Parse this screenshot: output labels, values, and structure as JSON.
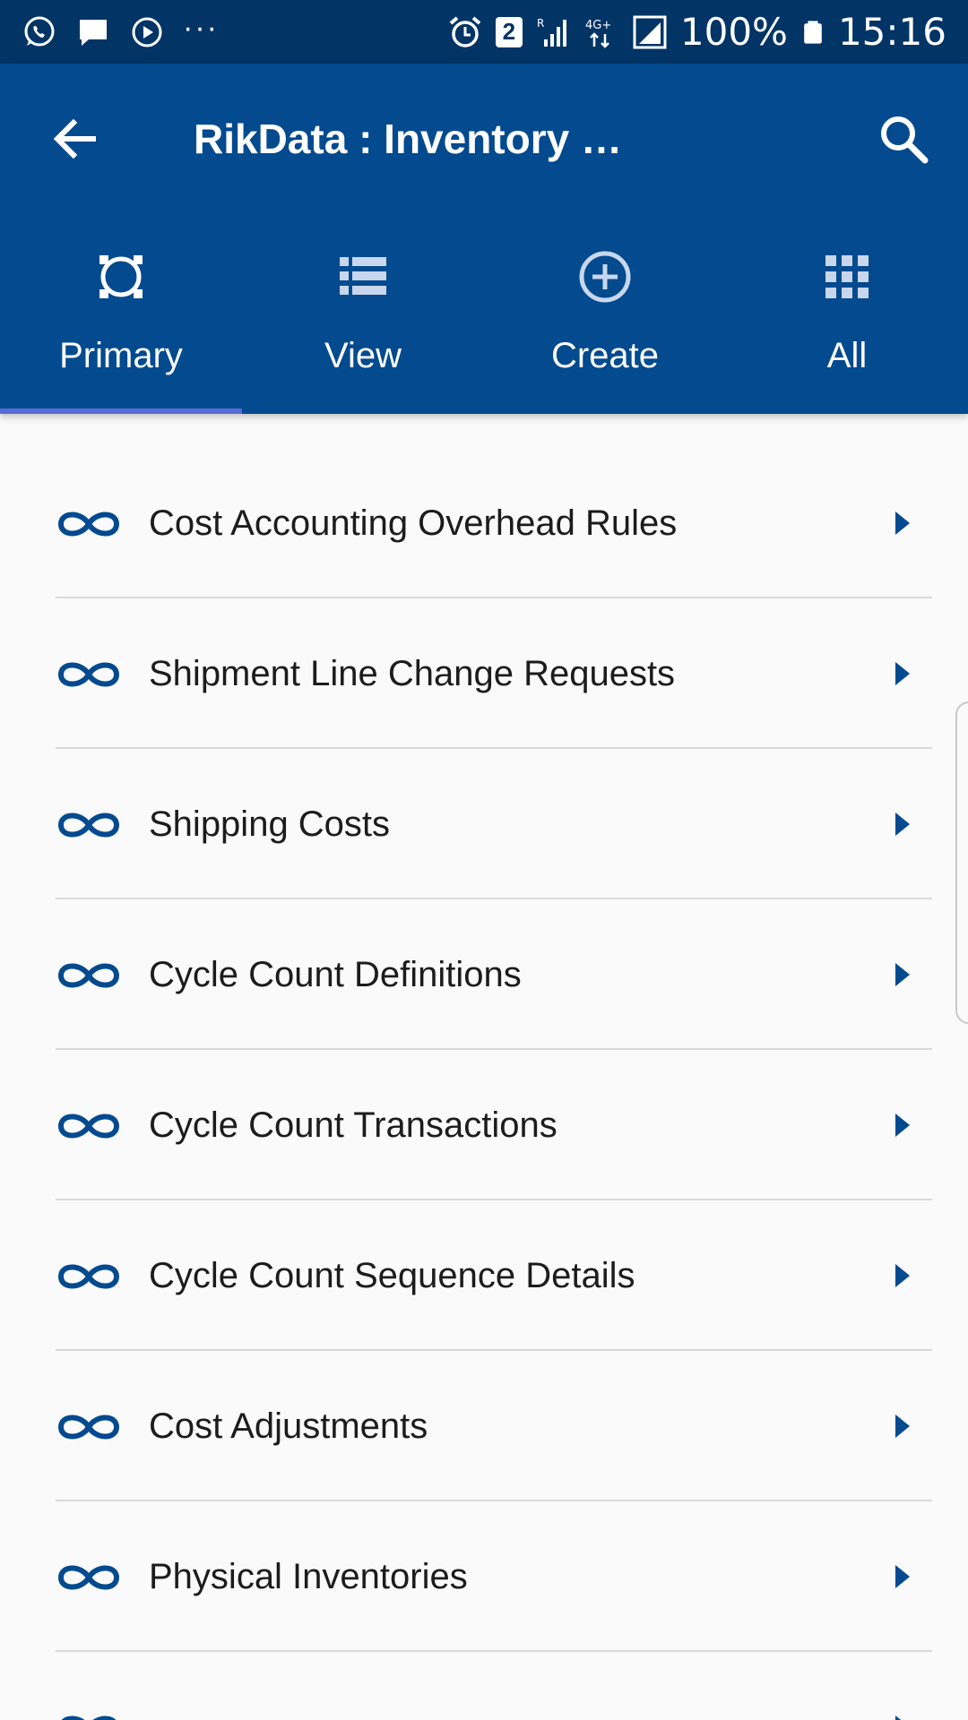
{
  "status_bar": {
    "battery_text": "100%",
    "time": "15:16",
    "sim_badge": "2",
    "network_label": "4G+",
    "roaming_label": "R",
    "left_icons": [
      "whatsapp-icon",
      "message-icon",
      "media-icon",
      "more-dots-icon"
    ],
    "right_icons": [
      "alarm-icon",
      "sim-badge-icon",
      "signal-icon",
      "signal-icon",
      "battery-icon"
    ]
  },
  "toolbar": {
    "title": "RikData : Inventory …",
    "back_icon": "arrow-back-icon",
    "search_icon": "search-icon"
  },
  "tabs": [
    {
      "label": "Primary",
      "icon": "primary-icon",
      "selected": true
    },
    {
      "label": "View",
      "icon": "list-view-icon",
      "selected": false
    },
    {
      "label": "Create",
      "icon": "add-circle-icon",
      "selected": false
    },
    {
      "label": "All",
      "icon": "grid-icon",
      "selected": false
    }
  ],
  "list": {
    "items": [
      {
        "label": "Cost Accounting Overhead Rules"
      },
      {
        "label": "Shipment Line Change Requests"
      },
      {
        "label": "Shipping Costs"
      },
      {
        "label": "Cycle Count Definitions"
      },
      {
        "label": "Cycle Count Transactions"
      },
      {
        "label": "Cycle Count Sequence Details"
      },
      {
        "label": "Cost Adjustments"
      },
      {
        "label": "Physical Inventories"
      }
    ],
    "item_icon": "infinity-link-icon",
    "chevron_icon": "chevron-right-icon"
  },
  "colors": {
    "status_bar": "#023466",
    "app_bar": "#034a8e",
    "accent": "#034a8e",
    "tab_indicator": "#5b6ad6",
    "background": "#fafafa"
  }
}
